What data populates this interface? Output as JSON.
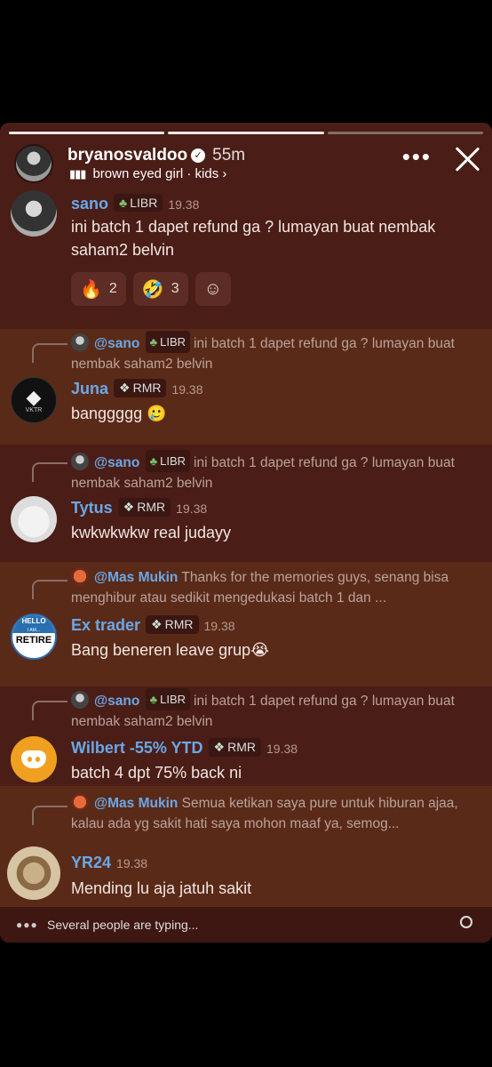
{
  "story": {
    "username": "bryanosvaldoo",
    "time": "55m",
    "music": "brown eyed girl · kids",
    "music_arrow": "›",
    "more_label": "•••"
  },
  "messages": [
    {
      "name": "sano",
      "tag": "LIBR",
      "time": "19.38",
      "text": "ini batch 1 dapet refund ga ? lumayan buat nembak saham2 belvin",
      "reactions": [
        {
          "emoji": "🔥",
          "count": "2"
        },
        {
          "emoji": "🤣",
          "count": "3"
        },
        {
          "emoji": "☺",
          "count": ""
        }
      ]
    },
    {
      "reply": {
        "name": "@sano",
        "tag": "LIBR",
        "text": "ini batch 1 dapet refund ga ? lumayan buat nembak saham2 belvin"
      },
      "name": "Juna",
      "tag": "RMR",
      "time": "19.38",
      "text": "banggggg 🥲",
      "avatar_label": "VKTR"
    },
    {
      "reply": {
        "name": "@sano",
        "tag": "LIBR",
        "text": "ini batch 1 dapet refund ga ? lumayan buat nembak saham2 belvin"
      },
      "name": "Tytus",
      "tag": "RMR",
      "time": "19.38",
      "text": "kwkwkwkw real judayy"
    },
    {
      "reply": {
        "name": "@Mas Mukin",
        "text": "Thanks for the memories guys, senang bisa menghibur atau sedikit mengedukasi batch 1 dan ..."
      },
      "name": "Ex trader",
      "tag": "RMR",
      "time": "19.38",
      "text": "Bang beneren leave grup😭",
      "avatar_top": "HELLO",
      "avatar_mid": "I AM...",
      "avatar_main": "RETIRE"
    },
    {
      "reply": {
        "name": "@sano",
        "tag": "LIBR",
        "text": "ini batch 1 dapet refund ga ? lumayan buat nembak saham2 belvin"
      },
      "name": "Wilbert -55% YTD",
      "tag": "RMR",
      "time": "19.38",
      "text": "batch 4 dpt 75% back ni"
    },
    {
      "reply": {
        "name": "@Mas Mukin",
        "text": "Semua ketikan saya pure untuk hiburan ajaa, kalau ada yg sakit hati saya mohon maaf  ya, semog..."
      },
      "name": "YR24",
      "time": "19.38",
      "text": "Mending lu aja jatuh sakit"
    }
  ],
  "typing": {
    "text": "Several people are typing..."
  },
  "colors": {
    "background": "#4a1d16",
    "name": "#6aa8e8",
    "reply_band": "#5a2a18"
  }
}
